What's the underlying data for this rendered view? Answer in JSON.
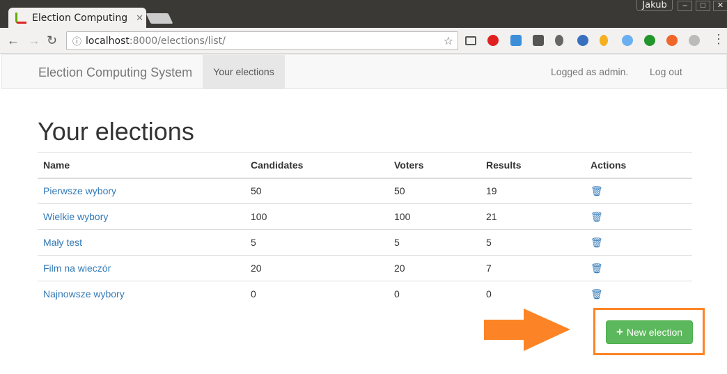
{
  "browser": {
    "tab_title": "Election Computing",
    "user": "Jakub",
    "url_host": "localhost",
    "url_rest": ":8000/elections/list/"
  },
  "navbar": {
    "brand": "Election Computing System",
    "active": "Your elections",
    "logged": "Logged as admin.",
    "logout": "Log out"
  },
  "page": {
    "title": "Your elections"
  },
  "table": {
    "headers": [
      "Name",
      "Candidates",
      "Voters",
      "Results",
      "Actions"
    ],
    "rows": [
      {
        "name": "Pierwsze wybory",
        "candidates": "50",
        "voters": "50",
        "results": "19"
      },
      {
        "name": "Wielkie wybory",
        "candidates": "100",
        "voters": "100",
        "results": "21"
      },
      {
        "name": "Mały test",
        "candidates": "5",
        "voters": "5",
        "results": "5"
      },
      {
        "name": "Film na wieczór",
        "candidates": "20",
        "voters": "20",
        "results": "7"
      },
      {
        "name": "Najnowsze wybory",
        "candidates": "0",
        "voters": "0",
        "results": "0"
      }
    ]
  },
  "new_button": "New election",
  "colors": {
    "accent": "#fd8426",
    "link": "#337ab7",
    "success": "#5cb85c"
  }
}
